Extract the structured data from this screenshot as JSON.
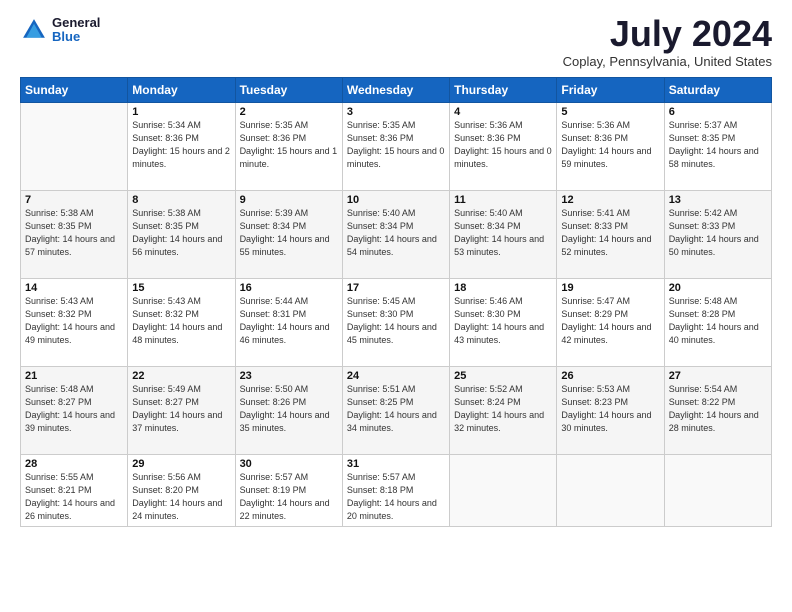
{
  "header": {
    "logo": {
      "general": "General",
      "blue": "Blue"
    },
    "title": "July 2024",
    "location": "Coplay, Pennsylvania, United States"
  },
  "weekdays": [
    "Sunday",
    "Monday",
    "Tuesday",
    "Wednesday",
    "Thursday",
    "Friday",
    "Saturday"
  ],
  "weeks": [
    [
      {
        "day": "",
        "sunrise": "",
        "sunset": "",
        "daylight": "",
        "empty": true
      },
      {
        "day": "1",
        "sunrise": "Sunrise: 5:34 AM",
        "sunset": "Sunset: 8:36 PM",
        "daylight": "Daylight: 15 hours and 2 minutes."
      },
      {
        "day": "2",
        "sunrise": "Sunrise: 5:35 AM",
        "sunset": "Sunset: 8:36 PM",
        "daylight": "Daylight: 15 hours and 1 minute."
      },
      {
        "day": "3",
        "sunrise": "Sunrise: 5:35 AM",
        "sunset": "Sunset: 8:36 PM",
        "daylight": "Daylight: 15 hours and 0 minutes."
      },
      {
        "day": "4",
        "sunrise": "Sunrise: 5:36 AM",
        "sunset": "Sunset: 8:36 PM",
        "daylight": "Daylight: 15 hours and 0 minutes."
      },
      {
        "day": "5",
        "sunrise": "Sunrise: 5:36 AM",
        "sunset": "Sunset: 8:36 PM",
        "daylight": "Daylight: 14 hours and 59 minutes."
      },
      {
        "day": "6",
        "sunrise": "Sunrise: 5:37 AM",
        "sunset": "Sunset: 8:35 PM",
        "daylight": "Daylight: 14 hours and 58 minutes."
      }
    ],
    [
      {
        "day": "7",
        "sunrise": "Sunrise: 5:38 AM",
        "sunset": "Sunset: 8:35 PM",
        "daylight": "Daylight: 14 hours and 57 minutes."
      },
      {
        "day": "8",
        "sunrise": "Sunrise: 5:38 AM",
        "sunset": "Sunset: 8:35 PM",
        "daylight": "Daylight: 14 hours and 56 minutes."
      },
      {
        "day": "9",
        "sunrise": "Sunrise: 5:39 AM",
        "sunset": "Sunset: 8:34 PM",
        "daylight": "Daylight: 14 hours and 55 minutes."
      },
      {
        "day": "10",
        "sunrise": "Sunrise: 5:40 AM",
        "sunset": "Sunset: 8:34 PM",
        "daylight": "Daylight: 14 hours and 54 minutes."
      },
      {
        "day": "11",
        "sunrise": "Sunrise: 5:40 AM",
        "sunset": "Sunset: 8:34 PM",
        "daylight": "Daylight: 14 hours and 53 minutes."
      },
      {
        "day": "12",
        "sunrise": "Sunrise: 5:41 AM",
        "sunset": "Sunset: 8:33 PM",
        "daylight": "Daylight: 14 hours and 52 minutes."
      },
      {
        "day": "13",
        "sunrise": "Sunrise: 5:42 AM",
        "sunset": "Sunset: 8:33 PM",
        "daylight": "Daylight: 14 hours and 50 minutes."
      }
    ],
    [
      {
        "day": "14",
        "sunrise": "Sunrise: 5:43 AM",
        "sunset": "Sunset: 8:32 PM",
        "daylight": "Daylight: 14 hours and 49 minutes."
      },
      {
        "day": "15",
        "sunrise": "Sunrise: 5:43 AM",
        "sunset": "Sunset: 8:32 PM",
        "daylight": "Daylight: 14 hours and 48 minutes."
      },
      {
        "day": "16",
        "sunrise": "Sunrise: 5:44 AM",
        "sunset": "Sunset: 8:31 PM",
        "daylight": "Daylight: 14 hours and 46 minutes."
      },
      {
        "day": "17",
        "sunrise": "Sunrise: 5:45 AM",
        "sunset": "Sunset: 8:30 PM",
        "daylight": "Daylight: 14 hours and 45 minutes."
      },
      {
        "day": "18",
        "sunrise": "Sunrise: 5:46 AM",
        "sunset": "Sunset: 8:30 PM",
        "daylight": "Daylight: 14 hours and 43 minutes."
      },
      {
        "day": "19",
        "sunrise": "Sunrise: 5:47 AM",
        "sunset": "Sunset: 8:29 PM",
        "daylight": "Daylight: 14 hours and 42 minutes."
      },
      {
        "day": "20",
        "sunrise": "Sunrise: 5:48 AM",
        "sunset": "Sunset: 8:28 PM",
        "daylight": "Daylight: 14 hours and 40 minutes."
      }
    ],
    [
      {
        "day": "21",
        "sunrise": "Sunrise: 5:48 AM",
        "sunset": "Sunset: 8:27 PM",
        "daylight": "Daylight: 14 hours and 39 minutes."
      },
      {
        "day": "22",
        "sunrise": "Sunrise: 5:49 AM",
        "sunset": "Sunset: 8:27 PM",
        "daylight": "Daylight: 14 hours and 37 minutes."
      },
      {
        "day": "23",
        "sunrise": "Sunrise: 5:50 AM",
        "sunset": "Sunset: 8:26 PM",
        "daylight": "Daylight: 14 hours and 35 minutes."
      },
      {
        "day": "24",
        "sunrise": "Sunrise: 5:51 AM",
        "sunset": "Sunset: 8:25 PM",
        "daylight": "Daylight: 14 hours and 34 minutes."
      },
      {
        "day": "25",
        "sunrise": "Sunrise: 5:52 AM",
        "sunset": "Sunset: 8:24 PM",
        "daylight": "Daylight: 14 hours and 32 minutes."
      },
      {
        "day": "26",
        "sunrise": "Sunrise: 5:53 AM",
        "sunset": "Sunset: 8:23 PM",
        "daylight": "Daylight: 14 hours and 30 minutes."
      },
      {
        "day": "27",
        "sunrise": "Sunrise: 5:54 AM",
        "sunset": "Sunset: 8:22 PM",
        "daylight": "Daylight: 14 hours and 28 minutes."
      }
    ],
    [
      {
        "day": "28",
        "sunrise": "Sunrise: 5:55 AM",
        "sunset": "Sunset: 8:21 PM",
        "daylight": "Daylight: 14 hours and 26 minutes."
      },
      {
        "day": "29",
        "sunrise": "Sunrise: 5:56 AM",
        "sunset": "Sunset: 8:20 PM",
        "daylight": "Daylight: 14 hours and 24 minutes."
      },
      {
        "day": "30",
        "sunrise": "Sunrise: 5:57 AM",
        "sunset": "Sunset: 8:19 PM",
        "daylight": "Daylight: 14 hours and 22 minutes."
      },
      {
        "day": "31",
        "sunrise": "Sunrise: 5:57 AM",
        "sunset": "Sunset: 8:18 PM",
        "daylight": "Daylight: 14 hours and 20 minutes."
      },
      {
        "day": "",
        "sunrise": "",
        "sunset": "",
        "daylight": "",
        "empty": true
      },
      {
        "day": "",
        "sunrise": "",
        "sunset": "",
        "daylight": "",
        "empty": true
      },
      {
        "day": "",
        "sunrise": "",
        "sunset": "",
        "daylight": "",
        "empty": true
      }
    ]
  ]
}
